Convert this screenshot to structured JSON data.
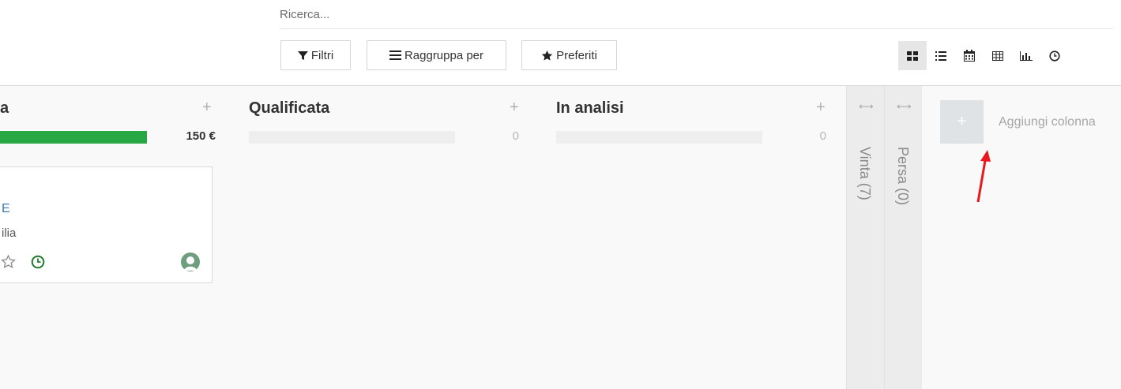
{
  "search": {
    "placeholder": "Ricerca..."
  },
  "toolbar": {
    "filters_label": "Filtri",
    "groupby_label": "Raggruppa per",
    "favorites_label": "Preferiti"
  },
  "view_switcher": {
    "views": [
      "kanban-icon",
      "list-icon",
      "calendar-icon",
      "pivot-icon",
      "graph-icon",
      "activity-icon"
    ],
    "active": "kanban-icon"
  },
  "columns": [
    {
      "title": "a",
      "amount": "150 €",
      "progress_fraction": 1.0,
      "progress_color": "#28a745"
    },
    {
      "title": "Qualificata",
      "amount": "0",
      "progress_fraction": 0
    },
    {
      "title": "In analisi",
      "amount": "0",
      "progress_fraction": 0
    }
  ],
  "card": {
    "fragment_1": "E",
    "fragment_2": "ilia",
    "icons": [
      "star-icon",
      "clock-icon",
      "avatar"
    ]
  },
  "folded_columns": [
    {
      "label": "Vinta (7)"
    },
    {
      "label": "Persa (0)"
    }
  ],
  "add_column": {
    "label": "Aggiungi colonna"
  },
  "colors": {
    "accent_green": "#28a745",
    "annotation_arrow": "#e8181e"
  }
}
